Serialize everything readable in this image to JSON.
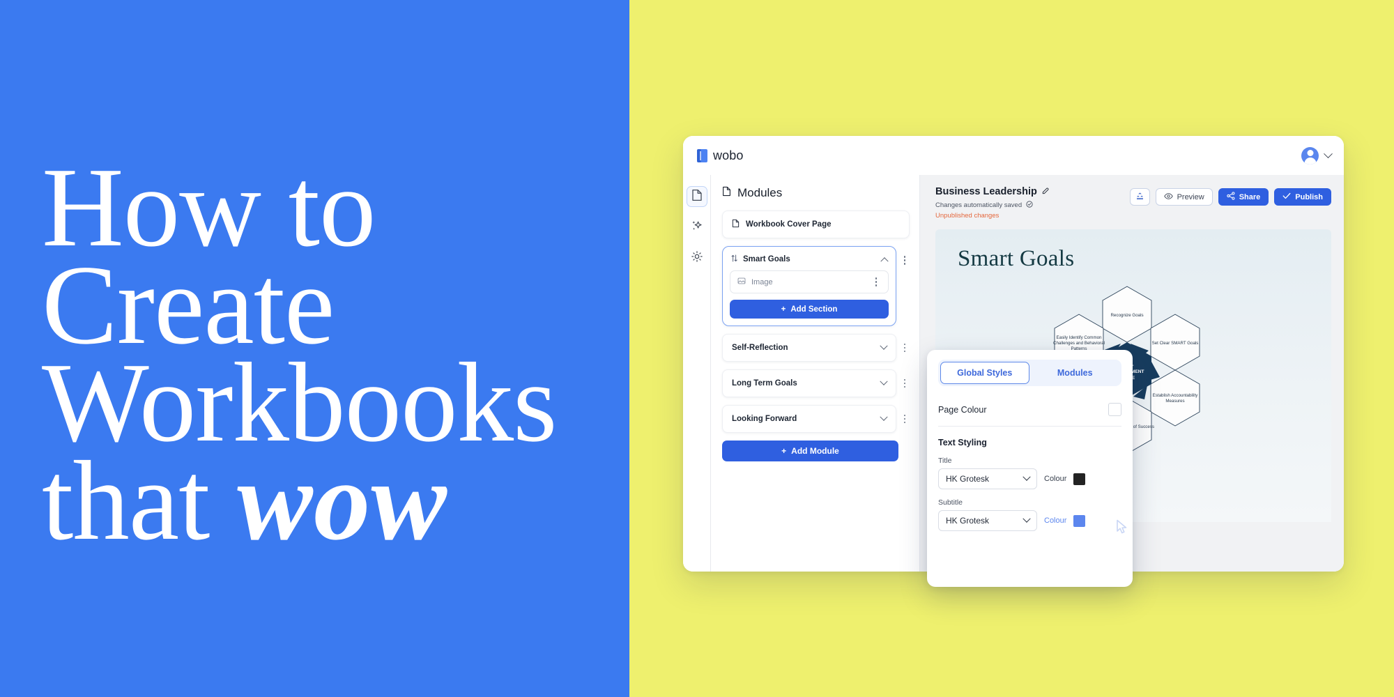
{
  "hero": {
    "lines": [
      "How to",
      "Create",
      "Workbooks"
    ],
    "last_line_prefix": "that ",
    "last_line_emphasis": "wow",
    "bg_color": "#3B7AF0",
    "text_color": "#FFFFFF"
  },
  "right_bg_color": "#EEF06E",
  "app": {
    "topbar": {
      "brand": "wobo",
      "brand_icon": "book-icon",
      "avatar_icon": "user-avatar",
      "chevron_icon": "chevron-down-icon"
    },
    "rail": [
      {
        "name": "pages",
        "icon": "document-icon",
        "active": true
      },
      {
        "name": "ai",
        "icon": "sparkle-icon",
        "active": false
      },
      {
        "name": "settings",
        "icon": "gear-icon",
        "active": false
      }
    ],
    "modules_pane": {
      "title": "Modules",
      "title_icon": "document-icon",
      "cover_page": {
        "label": "Workbook Cover Page",
        "icon": "document-icon"
      },
      "expanded_module": {
        "label": "Smart Goals",
        "reorder_icon": "sort-arrows-icon",
        "collapse_icon": "chevron-up-icon",
        "sections": [
          {
            "label": "Image",
            "icon": "image-icon"
          }
        ],
        "add_section_label": "Add Section"
      },
      "modules": [
        {
          "label": "Self-Reflection"
        },
        {
          "label": "Long Term Goals"
        },
        {
          "label": "Looking Forward"
        }
      ],
      "add_module_label": "Add Module"
    },
    "canvas": {
      "doc_title": "Business Leadership",
      "edit_icon": "edit-pencil-icon",
      "saved_text": "Changes automatically saved",
      "saved_icon": "check-circle-icon",
      "unpublished_text": "Unpublished changes",
      "actions": [
        {
          "label": "",
          "icon": "template-icon",
          "style": "icon"
        },
        {
          "label": "Preview",
          "icon": "eye-icon",
          "style": "outline"
        },
        {
          "label": "Share",
          "icon": "share-icon",
          "style": "primary"
        },
        {
          "label": "Publish",
          "icon": "check-icon",
          "style": "primary"
        }
      ],
      "page_heading": "Smart Goals",
      "diagram": {
        "center": "SELF-IMPROVEMENT CYCLE",
        "nodes": [
          "Recognize Goals",
          "Set Clear SMART Goals",
          "Establish Accountability Measures",
          "Create a System of Success",
          "Easily Identify Common Challenges and Behavioral Patterns"
        ]
      }
    },
    "styles_popup": {
      "tabs": [
        {
          "label": "Global Styles",
          "active": true
        },
        {
          "label": "Modules",
          "active": false
        }
      ],
      "page_colour_label": "Page Colour",
      "page_colour_value": "#FFFFFF",
      "text_styling_label": "Text Styling",
      "fields": [
        {
          "label": "Title",
          "font": "HK Grotesk",
          "colour_label": "Colour",
          "colour_value": "#232323"
        },
        {
          "label": "Subtitle",
          "font": "HK Grotesk",
          "colour_label": "Colour",
          "colour_value": "#5C86EE"
        }
      ]
    }
  }
}
